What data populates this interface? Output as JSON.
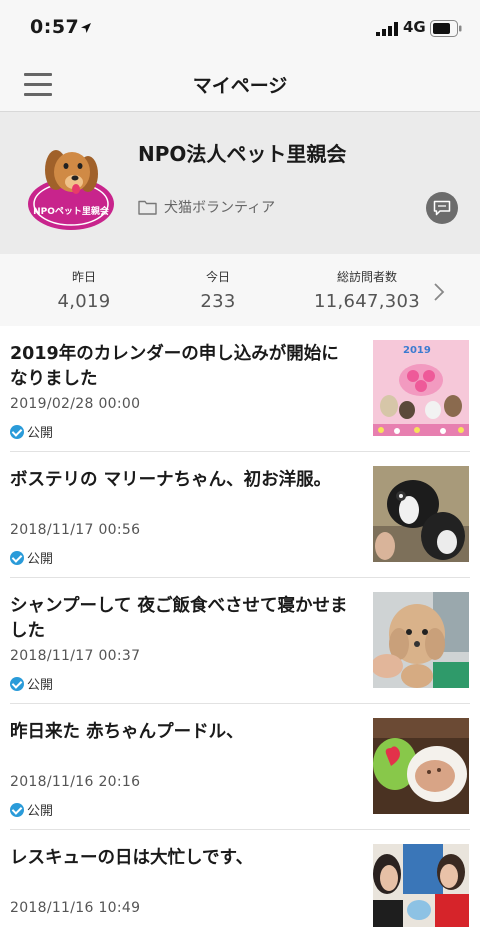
{
  "status_bar": {
    "time": "0:57",
    "network": "4G"
  },
  "nav": {
    "title": "マイページ"
  },
  "profile": {
    "name": "NPO法人ペット里親会",
    "category": "犬猫ボランティア",
    "logo_text": "NPOペット里親会"
  },
  "stats": [
    {
      "label": "昨日",
      "value": "4,019"
    },
    {
      "label": "今日",
      "value": "233"
    },
    {
      "label": "総訪問者数",
      "value": "11,647,303"
    }
  ],
  "posts": [
    {
      "title": "2019年のカレンダーの申し込みが開始になりました",
      "date": "2019/02/28 00:00",
      "status": "公開",
      "thumb_text": "2019"
    },
    {
      "title": "ボステリの マリーナちゃん、初お洋服。",
      "date": "2018/11/17 00:56",
      "status": "公開"
    },
    {
      "title": "シャンプーして 夜ご飯食べさせて寝かせました",
      "date": "2018/11/17 00:37",
      "status": "公開"
    },
    {
      "title": "昨日来た 赤ちゃんプードル、",
      "date": "2018/11/16 20:16",
      "status": "公開"
    },
    {
      "title": "レスキューの日は大忙しです、",
      "date": "2018/11/16 10:49",
      "status": ""
    }
  ],
  "colors": {
    "accent": "#2a9bd9",
    "logo_pink": "#c8248c",
    "header_bg": "#f7f7f7",
    "profile_bg": "#ebebeb"
  },
  "icons": [
    "location-arrow-icon",
    "signal-icon",
    "battery-icon",
    "hamburger-menu-icon",
    "folder-icon",
    "message-icon",
    "chevron-right-icon",
    "check-circle-icon"
  ]
}
